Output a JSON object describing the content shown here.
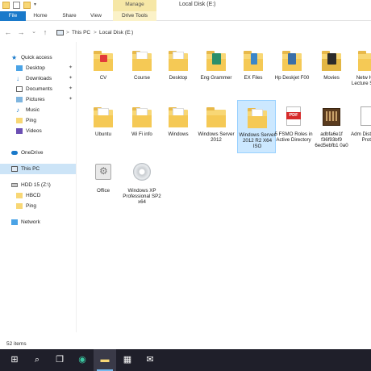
{
  "titlebar": {
    "title": "Local Disk (E:)",
    "manage_tab": "Manage"
  },
  "ribbon": {
    "tabs": [
      "File",
      "Home",
      "Share",
      "View",
      "Drive Tools"
    ]
  },
  "address": {
    "crumbs": [
      "This PC",
      "Local Disk (E:)"
    ],
    "separator": ">"
  },
  "sidebar": {
    "items": [
      {
        "label": "Quick access",
        "icon": "star-icon",
        "pinned": false
      },
      {
        "label": "Desktop",
        "icon": "desktop-icon",
        "pinned": true
      },
      {
        "label": "Downloads",
        "icon": "download-icon",
        "pinned": true
      },
      {
        "label": "Documents",
        "icon": "documents-icon",
        "pinned": true
      },
      {
        "label": "Pictures",
        "icon": "pictures-icon",
        "pinned": true
      },
      {
        "label": "Music",
        "icon": "music-icon",
        "pinned": false
      },
      {
        "label": "Ping",
        "icon": "folder-icon",
        "pinned": false
      },
      {
        "label": "Videos",
        "icon": "videos-icon",
        "pinned": false
      },
      {
        "label": "OneDrive",
        "icon": "cloud-icon",
        "pinned": false
      },
      {
        "label": "This PC",
        "icon": "pc-icon",
        "pinned": false
      },
      {
        "label": "HDD 15 (Z:\\)",
        "icon": "drive-icon",
        "pinned": false
      },
      {
        "label": "HBCD",
        "icon": "folder-icon",
        "pinned": false
      },
      {
        "label": "Ping",
        "icon": "folder-icon",
        "pinned": false
      },
      {
        "label": "Network",
        "icon": "network-icon",
        "pinned": false
      }
    ]
  },
  "files": [
    {
      "name": "CV",
      "kind": "folder-badge-red"
    },
    {
      "name": "Course",
      "kind": "folder"
    },
    {
      "name": "Desktop",
      "kind": "folder-doc"
    },
    {
      "name": "Eng Grammer",
      "kind": "folder-green"
    },
    {
      "name": "EX Files",
      "kind": "folder-blue"
    },
    {
      "name": "Hp Deskjet F00",
      "kind": "folder-printer"
    },
    {
      "name": "Movies",
      "kind": "folder-dark"
    },
    {
      "name": "Netw Help Lecture Suppo",
      "kind": "folder"
    },
    {
      "name": "Ubuntu",
      "kind": "folder"
    },
    {
      "name": "Wi Fi info",
      "kind": "folder-doc"
    },
    {
      "name": "Windows",
      "kind": "folder-doc"
    },
    {
      "name": "Windows Server 2012",
      "kind": "folder"
    },
    {
      "name": "Windows Server 2012 R2 X64 ISO",
      "kind": "folder-selected"
    },
    {
      "name": "5 FSMO Roles in Active Directory",
      "kind": "pdf"
    },
    {
      "name": "adbfa6e1f f36f93bf9 6ed5ebfb1 0a0",
      "kind": "image"
    },
    {
      "name": "Adm Distr Rout Proto",
      "kind": "pdf-white"
    },
    {
      "name": "Office",
      "kind": "settings"
    },
    {
      "name": "Windows XP Professional SP2 x64",
      "kind": "disc"
    }
  ],
  "status": {
    "count": "52 items"
  },
  "taskbar": {
    "items": [
      {
        "name": "start-button",
        "glyph": "⊞"
      },
      {
        "name": "search-button",
        "glyph": "⌕"
      },
      {
        "name": "task-view-button",
        "glyph": "❐"
      },
      {
        "name": "edge-button",
        "glyph": "◉"
      },
      {
        "name": "file-explorer-button",
        "glyph": "▬"
      },
      {
        "name": "store-button",
        "glyph": "▦"
      },
      {
        "name": "mail-button",
        "glyph": "✉"
      }
    ]
  },
  "colors": {
    "accent": "#1979ca",
    "folder": "#f8d775",
    "selection": "#cce8ff"
  }
}
